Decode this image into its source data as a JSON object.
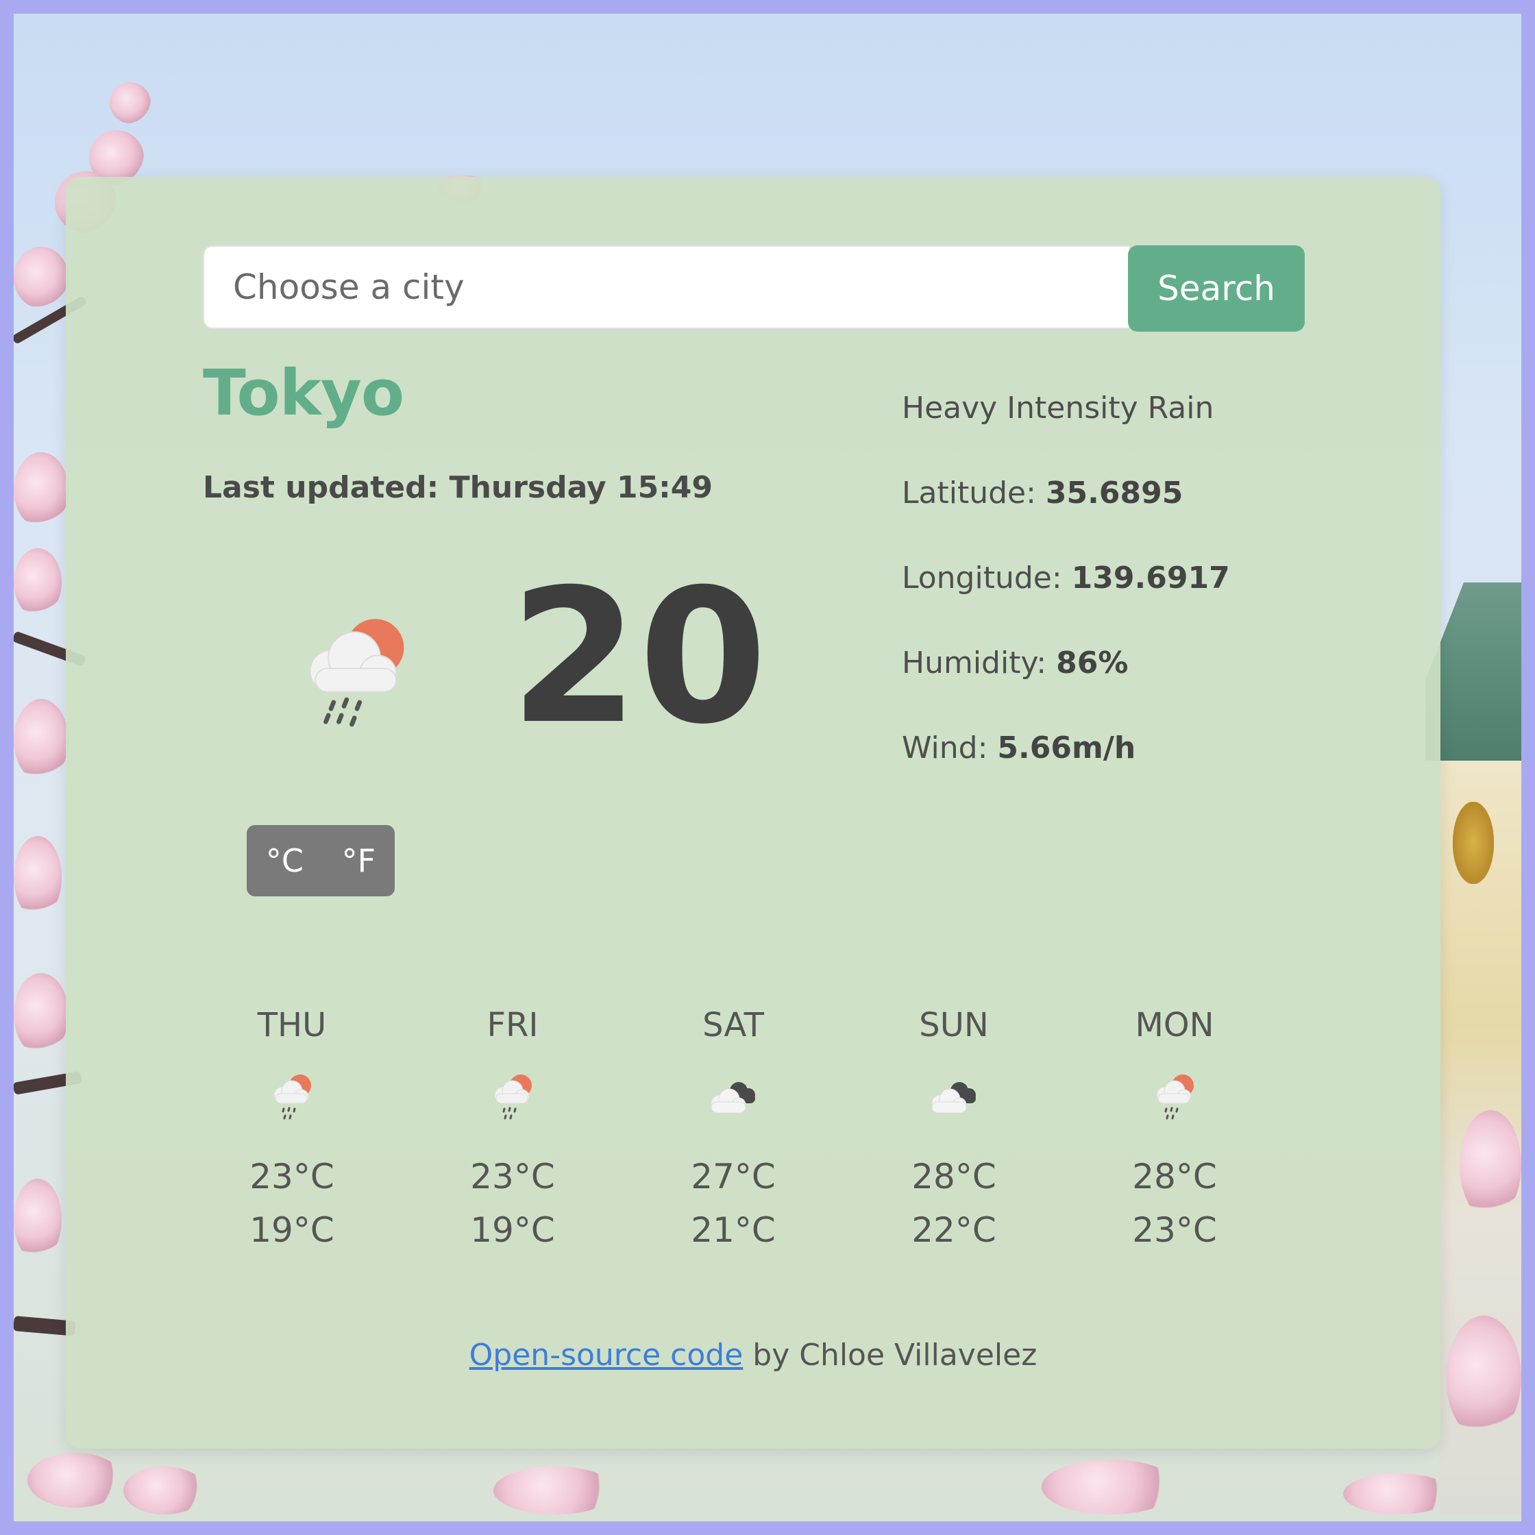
{
  "search": {
    "placeholder": "Choose a city",
    "button_label": "Search"
  },
  "current": {
    "city": "Tokyo",
    "last_updated": "Last updated: Thursday 15:49",
    "temperature": "20",
    "icon": "rain-sun-cloud-icon",
    "unit_celsius": "°C",
    "unit_fahrenheit": "°F"
  },
  "details": {
    "description": "Heavy Intensity Rain",
    "latitude_label": "Latitude:",
    "latitude_value": "35.6895",
    "longitude_label": "Longitude:",
    "longitude_value": "139.6917",
    "humidity_label": "Humidity:",
    "humidity_value": "86%",
    "wind_label": "Wind:",
    "wind_value": "5.66m/h"
  },
  "forecast": [
    {
      "day": "THU",
      "icon": "rain-sun-cloud-icon",
      "high": "23°C",
      "low": "19°C"
    },
    {
      "day": "FRI",
      "icon": "rain-sun-cloud-icon",
      "high": "23°C",
      "low": "19°C"
    },
    {
      "day": "SAT",
      "icon": "broken-clouds-icon",
      "high": "27°C",
      "low": "21°C"
    },
    {
      "day": "SUN",
      "icon": "broken-clouds-icon",
      "high": "28°C",
      "low": "22°C"
    },
    {
      "day": "MON",
      "icon": "rain-sun-cloud-icon",
      "high": "28°C",
      "low": "23°C"
    }
  ],
  "footer": {
    "link_text": "Open-source code",
    "suffix": " by Chloe Villavelez"
  },
  "colors": {
    "accent": "#62ae8a",
    "card_background": "#cde0c4",
    "link": "#3b7dde",
    "frame": "#a9a9f2"
  }
}
